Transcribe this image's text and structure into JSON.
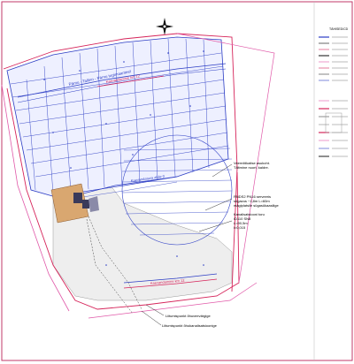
{
  "compass": {
    "north_label": ""
  },
  "legend": {
    "title": "TÄHISED/CD",
    "rows": 16
  },
  "labels": {
    "road_top": "Pärnu - Tallinn - Pärnu tugimaanteel",
    "road_red_top": "Kaevandamine km 12",
    "road_middle": "Kaevandatava alale 0",
    "road_bottom": "Kaevandamine km 12",
    "area_blue": "Vee-alal"
  },
  "annotations": [
    {
      "id": "a1",
      "lines": [
        "Veerežiikaitse asukoht.",
        "Täitmine nuort, kaldre."
      ]
    },
    {
      "id": "a2",
      "lines": [
        "RNDS2 PN16 serveeris",
        "sügavus ~1,8m L=60m",
        "mägiplatsile sügasükaasilige"
      ]
    },
    {
      "id": "a3",
      "lines": [
        "Kanalisatsiooni toru",
        "ID110 SN8",
        "L=90,5m",
        "i=0,015"
      ]
    },
    {
      "id": "a4",
      "lines": [
        "Liitumispunkt õhuveevärgige"
      ]
    },
    {
      "id": "a5",
      "lines": [
        "Liitumispunkt õhukanalisatsioonige"
      ]
    }
  ],
  "colors": {
    "contour_blue": "#2b3cc4",
    "boundary_red": "#d6245a",
    "boundary_pink": "#e058a8",
    "building_gold": "#d9a770",
    "building_dark": "#3a3a5a",
    "site_grey": "#e6e6e6"
  }
}
